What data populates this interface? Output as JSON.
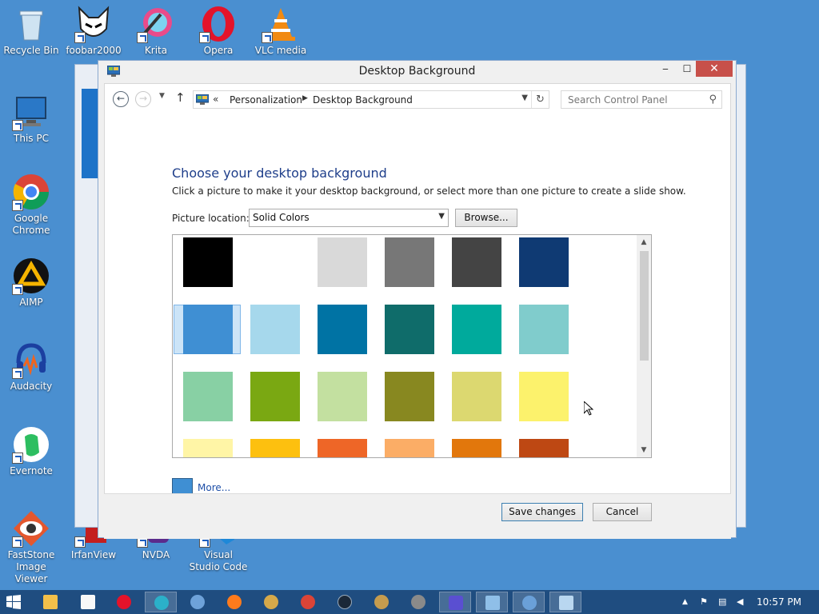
{
  "desktop": {
    "icons": [
      {
        "label": "Recycle Bin"
      },
      {
        "label": "foobar2000"
      },
      {
        "label": "Krita"
      },
      {
        "label": "Opera"
      },
      {
        "label": "VLC media"
      },
      {
        "label": "This PC"
      },
      {
        "label": "Google Chrome"
      },
      {
        "label": "AIMP"
      },
      {
        "label": "Audacity"
      },
      {
        "label": "Evernote"
      },
      {
        "label": "FastStone Image Viewer"
      },
      {
        "label": "IrfanView"
      },
      {
        "label": "NVDA"
      },
      {
        "label": "Visual Studio Code"
      }
    ]
  },
  "dialog": {
    "title": "Desktop Background",
    "minimize_glyph": "‒",
    "maximize_glyph": "☐",
    "close_glyph": "✕",
    "address": {
      "chevron": "«",
      "crumbs": [
        "Personalization",
        "Desktop Background"
      ],
      "separator": "▶"
    },
    "search_placeholder": "Search Control Panel",
    "heading": "Choose your desktop background",
    "subtext": "Click a picture to make it your desktop background, or select more than one picture to create a slide show.",
    "picture_location_label": "Picture location:",
    "picture_location_value": "Solid Colors",
    "browse_label": "Browse...",
    "more_label": "More...",
    "more_color": "#3f8fd3",
    "save_label": "Save changes",
    "cancel_label": "Cancel",
    "swatches": [
      [
        "#000000",
        "#ffffff",
        "#d9d9d9",
        "#777777",
        "#444444",
        "#0f3a73"
      ],
      [
        "#3f8fd3",
        "#a6d8ec",
        "#0073a4",
        "#0f6c6a",
        "#00aa9c",
        "#80cccc"
      ],
      [
        "#88d0a4",
        "#7aa812",
        "#c3e0a0",
        "#888820",
        "#dcd870",
        "#fcf26c"
      ],
      [
        "#fff5a6",
        "#fdc00f",
        "#ee6627",
        "#fbad66",
        "#e2770c",
        "#be4813"
      ]
    ],
    "selected_swatch": {
      "row": 1,
      "col": 0
    }
  },
  "taskbar": {
    "clock": "10:57 PM",
    "tray_caret": "▲"
  }
}
